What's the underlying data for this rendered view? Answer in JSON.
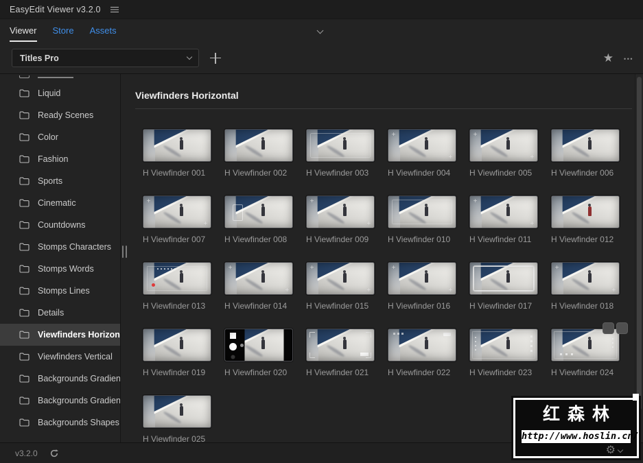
{
  "titlebar": {
    "title": "EasyEdit Viewer v3.2.0"
  },
  "tabbar": {
    "tabs": [
      {
        "label": "Viewer",
        "active": true
      },
      {
        "label": "Store",
        "active": false
      },
      {
        "label": "Assets",
        "active": false
      }
    ]
  },
  "toolbar": {
    "collection_selected": "Titles Pro",
    "star_icon": "★",
    "more_icon": "•••"
  },
  "sidebar": {
    "items": [
      {
        "label": "Liquid"
      },
      {
        "label": "Ready Scenes"
      },
      {
        "label": "Color"
      },
      {
        "label": "Fashion"
      },
      {
        "label": "Sports"
      },
      {
        "label": "Cinematic"
      },
      {
        "label": "Countdowns"
      },
      {
        "label": "Stomps Characters"
      },
      {
        "label": "Stomps Words"
      },
      {
        "label": "Stomps Lines"
      },
      {
        "label": "Details"
      },
      {
        "label": "Viewfinders Horizontal",
        "selected": true
      },
      {
        "label": "Viewfinders Vertical"
      },
      {
        "label": "Backgrounds Gradients L"
      },
      {
        "label": "Backgrounds Gradients D"
      },
      {
        "label": "Backgrounds Shapes Lig"
      }
    ]
  },
  "content": {
    "header": "Viewfinders Horizontal",
    "items": [
      {
        "label": "H Viewfinder 001",
        "variant": "plain"
      },
      {
        "label": "H Viewfinder 002",
        "variant": "plain"
      },
      {
        "label": "H Viewfinder 003",
        "variant": "frame-light"
      },
      {
        "label": "H Viewfinder 004",
        "variant": "ticks"
      },
      {
        "label": "H Viewfinder 005",
        "variant": "ticks"
      },
      {
        "label": "H Viewfinder 006",
        "variant": "plain"
      },
      {
        "label": "H Viewfinder 007",
        "variant": "ticks"
      },
      {
        "label": "H Viewfinder 008",
        "variant": "bracket-left"
      },
      {
        "label": "H Viewfinder 009",
        "variant": "ticks"
      },
      {
        "label": "H Viewfinder 010",
        "variant": "frame-light"
      },
      {
        "label": "H Viewfinder 011",
        "variant": "ticks"
      },
      {
        "label": "H Viewfinder 012",
        "variant": "red-figure"
      },
      {
        "label": "H Viewfinder 013",
        "variant": "rec"
      },
      {
        "label": "H Viewfinder 014",
        "variant": "ticks"
      },
      {
        "label": "H Viewfinder 015",
        "variant": "ticks"
      },
      {
        "label": "H Viewfinder 016",
        "variant": "ticks"
      },
      {
        "label": "H Viewfinder 017",
        "variant": "frame-bright"
      },
      {
        "label": "H Viewfinder 018",
        "variant": "ticks"
      },
      {
        "label": "H Viewfinder 019",
        "variant": "plain"
      },
      {
        "label": "H Viewfinder 020",
        "variant": "cam"
      },
      {
        "label": "H Viewfinder 021",
        "variant": "hud-brackets"
      },
      {
        "label": "H Viewfinder 022",
        "variant": "hud-top"
      },
      {
        "label": "H Viewfinder 023",
        "variant": "hud-side"
      },
      {
        "label": "H Viewfinder 024",
        "variant": "hud-frame",
        "actions": true
      },
      {
        "label": "H Viewfinder 025",
        "variant": "plain"
      }
    ]
  },
  "statusbar": {
    "version": "v3.2.0",
    "gear_icon": "⚙"
  },
  "watermark": {
    "title": "红森林",
    "url": "http://www.hoslin.cn/"
  },
  "colors": {
    "accent_blue": "#3f8ee8",
    "selection_bg": "#3c3c3c",
    "rec_red": "#e23b3b",
    "sky_blue": "#2b4a6f",
    "panel_bg": "#232323"
  }
}
